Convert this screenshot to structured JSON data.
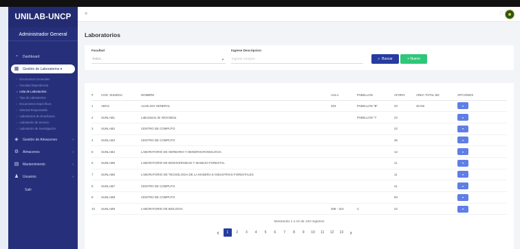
{
  "app": {
    "brand": "UNILAB-UNCP",
    "user_role": "Administrador General"
  },
  "sidebar": {
    "items": [
      {
        "label": "Dashboard",
        "icon": "dashboard-icon"
      },
      {
        "label": "Gestión de Laboratorios ▾",
        "icon": "building-icon",
        "active": true
      }
    ],
    "subitems": [
      "Documentos Generales",
      "Facultad Dependencia",
      "Lista de Laboratorios",
      "Tipo de Laboratorios",
      "Documentos Específicos",
      "Historial Responsable",
      "Laboratorios de Enseñanza",
      "Laboratorio de Servicio",
      "Laboratorio de Investigación"
    ],
    "selected_subitem": "Lista de Laboratorios",
    "lower_items": [
      {
        "label": "Gestión de Almacenes",
        "icon": "layers-icon"
      },
      {
        "label": "Almacenes",
        "icon": "gear-icon"
      },
      {
        "label": "Mantenimiento",
        "icon": "document-icon"
      },
      {
        "label": "Usuarios",
        "icon": "users-icon"
      }
    ],
    "logout": "Salir"
  },
  "header": {
    "menu_icon": "≡",
    "fullscreen_icon": "⛶"
  },
  "page": {
    "title": "Laboratorios"
  },
  "filters": {
    "faculty_label": "Facultad",
    "faculty_value": "Todos...",
    "search_label": "Ingrese Descripcion",
    "search_placeholder": "Ingrese Campos",
    "search_button": "Buscar",
    "new_button": "+ Nuevo"
  },
  "table": {
    "columns": [
      "#",
      "COD. SUNEDU",
      "NOMBRE",
      "AULA",
      "PABELLON",
      "AFORO",
      "AREA TOTAL M2",
      "OPCIONES"
    ],
    "rows": [
      [
        "1",
        "ABCS",
        "AUXILIOS GENERAL",
        "403",
        "PABELLON \"B\"",
        "40",
        "45 M2"
      ],
      [
        "2",
        "SUNLAB1",
        "Laboratorio de Informática",
        "",
        "PABELLON \"I\"",
        "22",
        ""
      ],
      [
        "3",
        "SUNLAB2",
        "CENTRO DE COMPUTO",
        "",
        "",
        "22",
        ""
      ],
      [
        "4",
        "SUNLAB3",
        "CENTRO DE COMPUTO",
        "",
        "",
        "36",
        ""
      ],
      [
        "5",
        "SUNLAB4",
        "LABORATORIO DE HERBARIO Y DENDROCRONOLOGIA",
        "",
        "",
        "12",
        ""
      ],
      [
        "6",
        "SUNLAB5",
        "LABORATORIO DE BIODIVERSIDAD Y MANEJO FORESTAL",
        "",
        "",
        "11",
        ""
      ],
      [
        "7",
        "SUNLAB6",
        "LABORATORIO DE TECNOLOGIA DE LA MADERA E INDUSTRIAS FORESTALES",
        "",
        "",
        "11",
        ""
      ],
      [
        "8",
        "SUNLAB7",
        "CENTRO DE COMPUTO",
        "",
        "",
        "41",
        ""
      ],
      [
        "9",
        "SUNLAB8",
        "CENTRO DE COMPUTO",
        "",
        "",
        "60",
        ""
      ],
      [
        "10",
        "SUNLAB9",
        "LABORATORIO DE BIOLOGIA",
        "309 - 310",
        "C",
        "22",
        ""
      ]
    ],
    "option_icon": "▾"
  },
  "pagination": {
    "info": "Mostrando 1 a 10 de 120 registros",
    "prev": "‹",
    "next": "›",
    "pages": [
      "1",
      "2",
      "3",
      "4",
      "5",
      "6",
      "7",
      "8",
      "9",
      "10",
      "11",
      "12",
      "13"
    ],
    "active": "1"
  },
  "colors": {
    "sidebar": "#26307a",
    "primary": "#263ca0",
    "success": "#2ec77a",
    "option": "#5f7ee6"
  }
}
